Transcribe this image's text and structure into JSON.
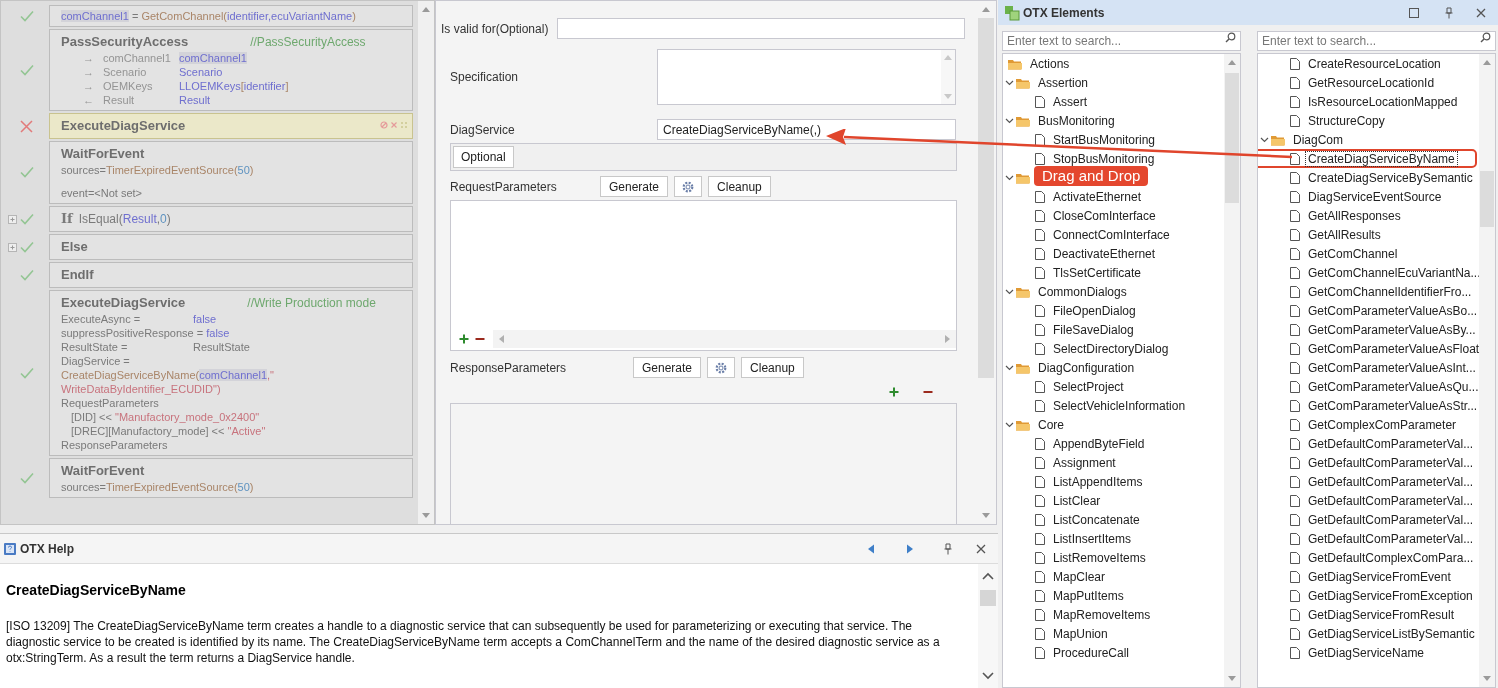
{
  "flow": {
    "steps": [
      {
        "passed": true,
        "selected": false,
        "collapsed": false,
        "lines": [
          {
            "kind": "code",
            "parts": [
              {
                "kind": "var_hl",
                "t": "comChannel1"
              },
              {
                "kind": "text",
                "t": " = "
              },
              {
                "kind": "func",
                "t": "GetComChannel("
              },
              {
                "kind": "var",
                "t": "identifier,ecuVariantName"
              },
              {
                "kind": "func",
                "t": ")"
              }
            ]
          }
        ]
      },
      {
        "passed": true,
        "selected": false,
        "collapsed": false,
        "lines": [
          {
            "kind": "head",
            "parts": [
              {
                "kind": "title",
                "t": "PassSecurityAccess"
              },
              {
                "kind": "comment",
                "t": "//PassSecurityAccess"
              }
            ]
          },
          {
            "kind": "arg",
            "parts": [
              {
                "kind": "dim",
                "t": "→"
              },
              {
                "kind": "dim",
                "t": "comChannel1"
              },
              {
                "kind": "var_hl",
                "t": "comChannel1"
              }
            ]
          },
          {
            "kind": "arg",
            "parts": [
              {
                "kind": "dim",
                "t": "→"
              },
              {
                "kind": "dim",
                "t": "Scenario"
              },
              {
                "kind": "var",
                "t": "Scenario"
              }
            ]
          },
          {
            "kind": "arg",
            "parts": [
              {
                "kind": "dim",
                "t": "→"
              },
              {
                "kind": "dim",
                "t": "OEMKeys"
              },
              {
                "kind": "var",
                "t": "LLOEMKeys"
              },
              {
                "kind": "func",
                "t": "["
              },
              {
                "kind": "var",
                "t": "identifier"
              },
              {
                "kind": "func",
                "t": "]"
              }
            ]
          },
          {
            "kind": "arg",
            "parts": [
              {
                "kind": "dim",
                "t": "←"
              },
              {
                "kind": "dim",
                "t": "Result"
              },
              {
                "kind": "var",
                "t": "Result"
              }
            ]
          }
        ]
      },
      {
        "passed": false,
        "selected": true,
        "collapsed": false,
        "lines": [
          {
            "kind": "head",
            "parts": [
              {
                "kind": "title",
                "t": "ExecuteDiagService"
              }
            ]
          }
        ]
      },
      {
        "passed": true,
        "selected": false,
        "collapsed": false,
        "lines": [
          {
            "kind": "head",
            "parts": [
              {
                "kind": "title",
                "t": "WaitForEvent"
              }
            ]
          },
          {
            "kind": "code",
            "parts": [
              {
                "kind": "text",
                "t": "sources="
              },
              {
                "kind": "func",
                "t": "TimerExpiredEventSource("
              },
              {
                "kind": "num",
                "t": "50"
              },
              {
                "kind": "func",
                "t": ")"
              }
            ]
          },
          {
            "kind": "spacer"
          },
          {
            "kind": "code",
            "parts": [
              {
                "kind": "text",
                "t": "event=<Not set>"
              }
            ]
          }
        ]
      },
      {
        "passed": true,
        "selected": false,
        "collapsed": true,
        "lines": [
          {
            "kind": "head",
            "parts": [
              {
                "kind": "kw",
                "t": "If"
              },
              {
                "kind": "text",
                "t": "IsEqual("
              },
              {
                "kind": "var",
                "t": "Result"
              },
              {
                "kind": "text",
                "t": ","
              },
              {
                "kind": "num",
                "t": "0"
              },
              {
                "kind": "text",
                "t": ")"
              }
            ]
          }
        ]
      },
      {
        "passed": true,
        "selected": false,
        "collapsed": true,
        "lines": [
          {
            "kind": "head",
            "parts": [
              {
                "kind": "title",
                "t": "Else"
              }
            ]
          }
        ]
      },
      {
        "passed": true,
        "selected": false,
        "collapsed": false,
        "lines": [
          {
            "kind": "head",
            "parts": [
              {
                "kind": "title",
                "t": "EndIf"
              }
            ]
          }
        ]
      },
      {
        "passed": true,
        "selected": false,
        "collapsed": false,
        "lines": [
          {
            "kind": "head",
            "parts": [
              {
                "kind": "title",
                "t": "ExecuteDiagService"
              },
              {
                "kind": "comment",
                "t": "//Write Production mode"
              }
            ]
          },
          {
            "kind": "assign",
            "parts": [
              {
                "kind": "text",
                "t": "ExecuteAsync ="
              },
              {
                "kind": "var",
                "t": "false"
              }
            ]
          },
          {
            "kind": "code",
            "parts": [
              {
                "kind": "text",
                "t": "suppressPositiveResponse = "
              },
              {
                "kind": "var",
                "t": "false"
              }
            ]
          },
          {
            "kind": "assign",
            "parts": [
              {
                "kind": "text",
                "t": "ResultState ="
              },
              {
                "kind": "text",
                "t": "ResultState"
              }
            ]
          },
          {
            "kind": "assign",
            "parts": [
              {
                "kind": "text",
                "t": "DiagService ="
              },
              {
                "kind": "func",
                "t": "CreateDiagServiceByName("
              },
              {
                "kind": "var_hl",
                "t": "comChannel1"
              },
              {
                "kind": "str",
                "t": ",\" WriteDataByIdentifier_ECUDID\")"
              }
            ]
          },
          {
            "kind": "code",
            "parts": [
              {
                "kind": "text",
                "t": "RequestParameters"
              }
            ]
          },
          {
            "kind": "sub",
            "parts": [
              {
                "kind": "text",
                "t": "[DID] << "
              },
              {
                "kind": "str",
                "t": "\"Manufactory_mode_0x2400\""
              }
            ]
          },
          {
            "kind": "sub",
            "parts": [
              {
                "kind": "text",
                "t": "[DREC][Manufactory_mode] << "
              },
              {
                "kind": "str",
                "t": "\"Active\""
              }
            ]
          },
          {
            "kind": "code",
            "parts": [
              {
                "kind": "text",
                "t": "ResponseParameters"
              }
            ]
          }
        ]
      },
      {
        "passed": true,
        "selected": false,
        "collapsed": false,
        "lines": [
          {
            "kind": "head",
            "parts": [
              {
                "kind": "title",
                "t": "WaitForEvent"
              }
            ]
          },
          {
            "kind": "code",
            "parts": [
              {
                "kind": "text",
                "t": "sources="
              },
              {
                "kind": "func",
                "t": "TimerExpiredEventSource("
              },
              {
                "kind": "num",
                "t": "50"
              },
              {
                "kind": "func",
                "t": ")"
              }
            ]
          }
        ]
      }
    ]
  },
  "form": {
    "valid_for": {
      "label": "Is valid for(Optional)"
    },
    "specification": {
      "label": "Specification"
    },
    "diag_service": {
      "label": "DiagService",
      "value": "CreateDiagServiceByName(,)"
    },
    "optional_button": "Optional",
    "request": {
      "label": "RequestParameters",
      "buttons": [
        {
          "kind": "generate",
          "label": "Generate"
        },
        {
          "kind": "settings"
        },
        {
          "kind": "cleanup",
          "label": "Cleanup"
        }
      ]
    },
    "response": {
      "label": "ResponseParameters",
      "buttons": [
        {
          "kind": "generate",
          "label": "Generate"
        },
        {
          "kind": "settings"
        },
        {
          "kind": "cleanup",
          "label": "Cleanup"
        }
      ]
    }
  },
  "annotation": {
    "label": "Drag and Drop"
  },
  "help": {
    "title": "OTX Help",
    "heading": "CreateDiagServiceByName",
    "body": "[ISO 13209] The CreateDiagServiceByName term creates a handle to a diagnostic service that can subsequently be used for parameterizing or executing that service. The diagnostic service to be created is identified by its name. The CreateDiagServiceByName term accepts a ComChannelTerm and the name of the desired diagnostic service as a otx:StringTerm. As a result the term returns a DiagService handle."
  },
  "elements": {
    "title": "OTX Elements",
    "search_placeholders": [
      "Enter text to search...",
      "Enter text to search..."
    ],
    "left_tree": {
      "items": [
        {
          "label": "Actions",
          "selected": false,
          "children": [
            {
              "label": "Assertion",
              "selected": false,
              "expanded": true,
              "children": [
                {
                  "label": "Assert",
                  "selected": false
                }
              ]
            },
            {
              "label": "BusMonitoring",
              "selected": false,
              "expanded": true,
              "children": [
                {
                  "label": "StartBusMonitoring",
                  "selected": false
                },
                {
                  "label": "StopBusMonitoring",
                  "selected": false
                }
              ]
            },
            {
              "expanded": true,
              "children": [
                {
                  "label": "ActivateEthernet",
                  "selected": false
                },
                {
                  "label": "CloseComInterface",
                  "selected": false
                },
                {
                  "label": "ConnectComInterface",
                  "selected": false
                },
                {
                  "label": "DeactivateEthernet",
                  "selected": false
                },
                {
                  "label": "TlsSetCertificate",
                  "selected": false
                }
              ]
            },
            {
              "label": "CommonDialogs",
              "selected": false,
              "expanded": true,
              "children": [
                {
                  "label": "FileOpenDialog",
                  "selected": false
                },
                {
                  "label": "FileSaveDialog",
                  "selected": false
                },
                {
                  "label": "SelectDirectoryDialog",
                  "selected": false
                }
              ]
            },
            {
              "label": "DiagConfiguration",
              "selected": false,
              "expanded": true,
              "children": [
                {
                  "label": "SelectProject",
                  "selected": false
                },
                {
                  "label": "SelectVehicleInformation",
                  "selected": false
                }
              ]
            },
            {
              "label": "Core",
              "selected": false,
              "expanded": true,
              "children": [
                {
                  "label": "AppendByteField",
                  "selected": false
                },
                {
                  "label": "Assignment",
                  "selected": false
                },
                {
                  "label": "ListAppendItems",
                  "selected": false
                },
                {
                  "label": "ListClear",
                  "selected": false
                },
                {
                  "label": "ListConcatenate",
                  "selected": false
                },
                {
                  "label": "ListInsertItems",
                  "selected": false
                },
                {
                  "label": "ListRemoveItems",
                  "selected": false
                },
                {
                  "label": "MapClear",
                  "selected": false
                },
                {
                  "label": "MapPutItems",
                  "selected": false
                },
                {
                  "label": "MapRemoveItems",
                  "selected": false
                },
                {
                  "label": "MapUnion",
                  "selected": false
                },
                {
                  "label": "ProcedureCall",
                  "selected": false
                }
              ]
            }
          ]
        }
      ]
    },
    "right_tree": {
      "items": [
        {
          "children": [
            {
              "label": "CreateResourceLocation",
              "selected": false
            },
            {
              "label": "GetResourceLocationId",
              "selected": false
            },
            {
              "label": "IsResourceLocationMapped",
              "selected": false
            },
            {
              "label": "StructureCopy",
              "selected": false
            }
          ]
        },
        {
          "label": "DiagCom",
          "selected": false,
          "expanded": true,
          "children": [
            {
              "label": "CreateDiagServiceByName",
              "selected": true
            },
            {
              "label": "CreateDiagServiceBySemantic",
              "selected": false
            },
            {
              "label": "DiagServiceEventSource",
              "selected": false
            },
            {
              "label": "GetAllResponses",
              "selected": false
            },
            {
              "label": "GetAllResults",
              "selected": false
            },
            {
              "label": "GetComChannel",
              "selected": false
            },
            {
              "label": "GetComChannelEcuVariantNa...",
              "selected": false
            },
            {
              "label": "GetComChannelIdentifierFro...",
              "selected": false
            },
            {
              "label": "GetComParameterValueAsBo...",
              "selected": false
            },
            {
              "label": "GetComParameterValueAsBy...",
              "selected": false
            },
            {
              "label": "GetComParameterValueAsFloat",
              "selected": false
            },
            {
              "label": "GetComParameterValueAsInt...",
              "selected": false
            },
            {
              "label": "GetComParameterValueAsQu...",
              "selected": false
            },
            {
              "label": "GetComParameterValueAsStr...",
              "selected": false
            },
            {
              "label": "GetComplexComParameter",
              "selected": false
            },
            {
              "label": "GetDefaultComParameterVal...",
              "selected": false
            },
            {
              "label": "GetDefaultComParameterVal...",
              "selected": false
            },
            {
              "label": "GetDefaultComParameterVal...",
              "selected": false
            },
            {
              "label": "GetDefaultComParameterVal...",
              "selected": false
            },
            {
              "label": "GetDefaultComParameterVal...",
              "selected": false
            },
            {
              "label": "GetDefaultComParameterVal...",
              "selected": false
            },
            {
              "label": "GetDefaultComplexComPara...",
              "selected": false
            },
            {
              "label": "GetDiagServiceFromEvent",
              "selected": false
            },
            {
              "label": "GetDiagServiceFromException",
              "selected": false
            },
            {
              "label": "GetDiagServiceFromResult",
              "selected": false
            },
            {
              "label": "GetDiagServiceListBySemantic",
              "selected": false
            },
            {
              "label": "GetDiagServiceName",
              "selected": false
            }
          ]
        }
      ]
    }
  }
}
